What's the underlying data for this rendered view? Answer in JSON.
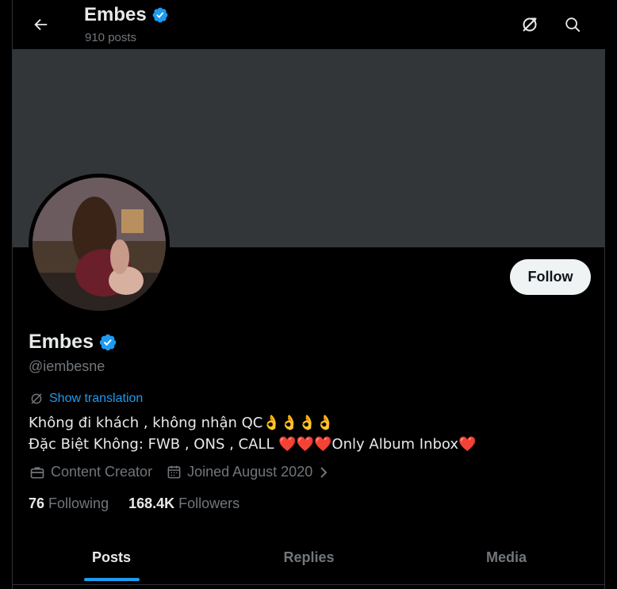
{
  "header": {
    "title": "Embes",
    "post_count": "910 posts"
  },
  "profile": {
    "name": "Embes",
    "handle": "@iembesne",
    "follow_label": "Follow",
    "show_translation": "Show translation",
    "bio_line1": "Không đi khách , không nhận QC👌👌👌👌",
    "bio_line2": "Đặc Biệt Không: FWB , ONS , CALL ❤️❤️❤️Only Album Inbox❤️",
    "category": "Content Creator",
    "joined": "Joined August 2020",
    "following_count": "76",
    "following_label": "Following",
    "followers_count": "168.4K",
    "followers_label": "Followers"
  },
  "tabs": [
    {
      "label": "Posts",
      "active": true
    },
    {
      "label": "Replies",
      "active": false
    },
    {
      "label": "Media",
      "active": false
    }
  ],
  "colors": {
    "background": "#000000",
    "banner": "#333639",
    "accent": "#1d9bf0",
    "muted": "#71767b",
    "verified": "#1d9bf0"
  }
}
